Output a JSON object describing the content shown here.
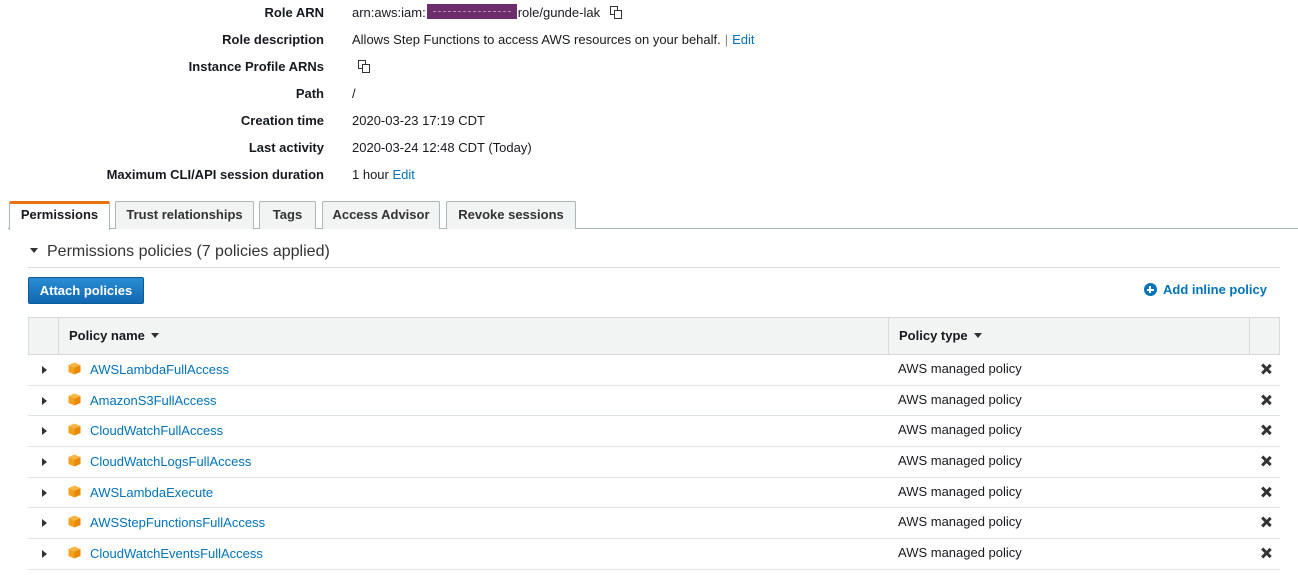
{
  "summary": {
    "role_arn": {
      "label": "Role ARN",
      "prefix": "arn:aws:iam:",
      "suffix": "role/gunde-lak"
    },
    "role_description": {
      "label": "Role description",
      "value": "Allows Step Functions to access AWS resources on your behalf.",
      "separator": "|",
      "edit": "Edit"
    },
    "instance_profile": {
      "label": "Instance Profile ARNs"
    },
    "path": {
      "label": "Path",
      "value": "/"
    },
    "creation_time": {
      "label": "Creation time",
      "value": "2020-03-23 17:19 CDT"
    },
    "last_activity": {
      "label": "Last activity",
      "value": "2020-03-24 12:48 CDT (Today)"
    },
    "max_session": {
      "label": "Maximum CLI/API session duration",
      "value": "1 hour",
      "edit": "Edit"
    }
  },
  "tabs": [
    {
      "label": "Permissions",
      "active": true
    },
    {
      "label": "Trust relationships",
      "active": false
    },
    {
      "label": "Tags",
      "active": false
    },
    {
      "label": "Access Advisor",
      "active": false
    },
    {
      "label": "Revoke sessions",
      "active": false
    }
  ],
  "permissions": {
    "heading": "Permissions policies (7 policies applied)",
    "attach_button": "Attach policies",
    "add_inline": "Add inline policy",
    "columns": {
      "name": "Policy name",
      "type": "Policy type"
    },
    "policies": [
      {
        "name": "AWSLambdaFullAccess",
        "type": "AWS managed policy"
      },
      {
        "name": "AmazonS3FullAccess",
        "type": "AWS managed policy"
      },
      {
        "name": "CloudWatchFullAccess",
        "type": "AWS managed policy"
      },
      {
        "name": "CloudWatchLogsFullAccess",
        "type": "AWS managed policy"
      },
      {
        "name": "AWSLambdaExecute",
        "type": "AWS managed policy"
      },
      {
        "name": "AWSStepFunctionsFullAccess",
        "type": "AWS managed policy"
      },
      {
        "name": "CloudWatchEventsFullAccess",
        "type": "AWS managed policy"
      }
    ]
  },
  "colors": {
    "link": "#0073bb",
    "accent": "#ec7211",
    "button": "#1167b1",
    "box_icon": "#f5a01a"
  }
}
